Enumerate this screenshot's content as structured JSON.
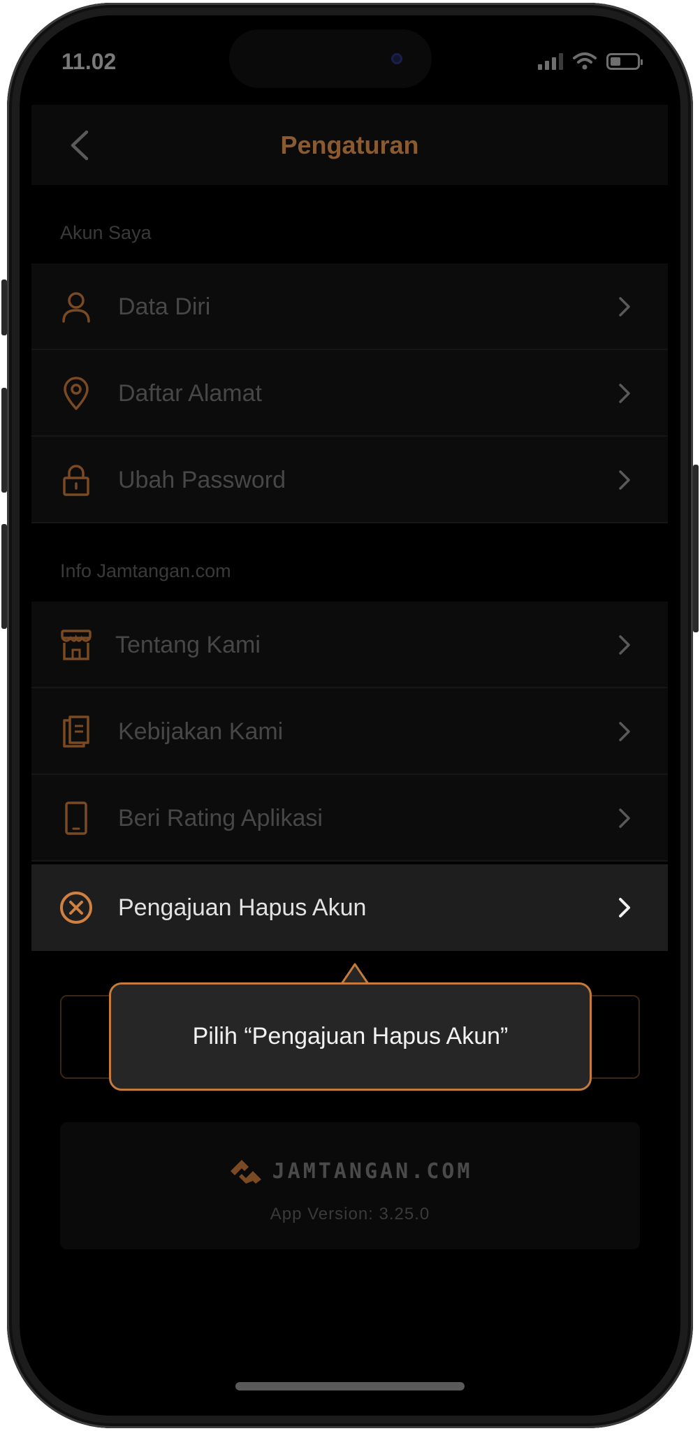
{
  "status_bar": {
    "time": "11.02"
  },
  "header": {
    "title": "Pengaturan"
  },
  "sections": [
    {
      "label": "Akun Saya",
      "items": [
        {
          "label": "Data Diri",
          "icon": "user-icon"
        },
        {
          "label": "Daftar Alamat",
          "icon": "location-pin-icon"
        },
        {
          "label": "Ubah Password",
          "icon": "lock-icon"
        }
      ]
    },
    {
      "label": "Info Jamtangan.com",
      "items": [
        {
          "label": "Tentang Kami",
          "icon": "store-icon"
        },
        {
          "label": "Kebijakan Kami",
          "icon": "clipboard-icon"
        },
        {
          "label": "Beri Rating Aplikasi",
          "icon": "phone-icon"
        },
        {
          "label": "Pengajuan Hapus Akun",
          "icon": "close-circle-icon"
        }
      ]
    }
  ],
  "tooltip": {
    "text": "Pilih “Pengajuan Hapus Akun”"
  },
  "footer": {
    "brand": "JAMTANGAN.COM",
    "version": "App Version: 3.25.0"
  },
  "colors": {
    "accent": "#c47b3c",
    "background": "#000000",
    "active_row": "#1e1e1e"
  }
}
